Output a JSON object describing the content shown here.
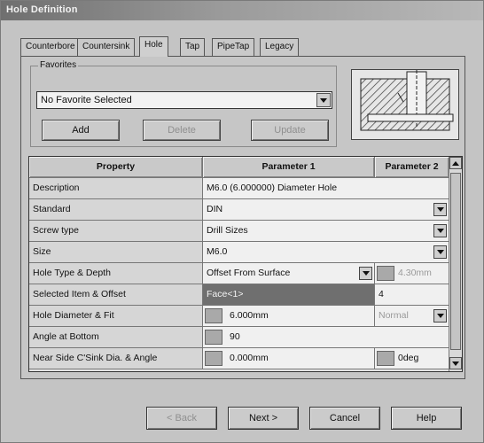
{
  "window": {
    "title": "Hole Definition"
  },
  "tabs": [
    {
      "label": "Counterbore",
      "active": false
    },
    {
      "label": "Countersink",
      "active": false
    },
    {
      "label": "Hole",
      "active": true
    },
    {
      "label": "Tap",
      "active": false
    },
    {
      "label": "PipeTap",
      "active": false
    },
    {
      "label": "Legacy",
      "active": false
    }
  ],
  "favorites": {
    "group_label": "Favorites",
    "selected": "No Favorite Selected",
    "add_label": "Add",
    "delete_label": "Delete",
    "update_label": "Update"
  },
  "grid": {
    "headers": {
      "property": "Property",
      "param1": "Parameter 1",
      "param2": "Parameter 2"
    },
    "rows": [
      {
        "property": "Description",
        "param1": "M6.0 (6.000000) Diameter Hole",
        "param2": ""
      },
      {
        "property": "Standard",
        "param1": "DIN",
        "param2": ""
      },
      {
        "property": "Screw type",
        "param1": "Drill Sizes",
        "param2": ""
      },
      {
        "property": "Size",
        "param1": "M6.0",
        "param2": ""
      },
      {
        "property": "Hole Type & Depth",
        "param1": "Offset From Surface",
        "param2": "4.30mm"
      },
      {
        "property": "Selected Item & Offset",
        "param1": "Face<1>",
        "param2": "4"
      },
      {
        "property": "Hole Diameter & Fit",
        "param1": "6.000mm",
        "param2": "Normal"
      },
      {
        "property": "Angle at Bottom",
        "param1": "90",
        "param2": ""
      },
      {
        "property": "Near Side C'Sink Dia. & Angle",
        "param1": "0.000mm",
        "param2": "0deg"
      }
    ]
  },
  "footer": {
    "back_label": "< Back",
    "next_label": "Next >",
    "cancel_label": "Cancel",
    "help_label": "Help"
  }
}
